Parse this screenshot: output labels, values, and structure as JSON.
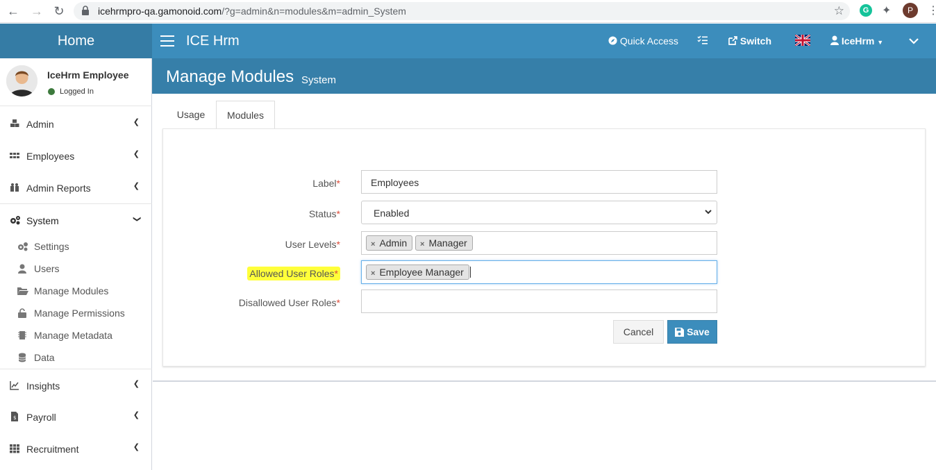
{
  "browser": {
    "url_host": "icehrmpro-qa.gamonoid.com",
    "url_path": "/?g=admin&n=modules&m=admin_System",
    "profile_initial": "P",
    "grammarly_letter": "G"
  },
  "header": {
    "logo_text": "Home",
    "app_title": "ICE Hrm",
    "quick_access": "Quick Access",
    "switch_label": "Switch",
    "user_menu": "IceHrm"
  },
  "user_panel": {
    "name": "IceHrm Employee",
    "status": "Logged In"
  },
  "sidebar": {
    "items": [
      {
        "label": "Admin"
      },
      {
        "label": "Employees"
      },
      {
        "label": "Admin Reports"
      },
      {
        "label": "System"
      },
      {
        "label": "Insights"
      },
      {
        "label": "Payroll"
      },
      {
        "label": "Recruitment"
      }
    ],
    "system_sub": [
      {
        "label": "Settings"
      },
      {
        "label": "Users"
      },
      {
        "label": "Manage Modules"
      },
      {
        "label": "Manage Permissions"
      },
      {
        "label": "Manage Metadata"
      },
      {
        "label": "Data"
      }
    ]
  },
  "page": {
    "title": "Manage Modules",
    "subtitle": "System"
  },
  "tabs": [
    {
      "label": "Usage"
    },
    {
      "label": "Modules"
    }
  ],
  "form": {
    "label_label": "Label",
    "label_value": "Employees",
    "status_label": "Status",
    "status_value": "Enabled",
    "user_levels_label": "User Levels",
    "user_levels": [
      "Admin",
      "Manager"
    ],
    "allowed_roles_label": "Allowed User Roles",
    "allowed_roles": [
      "Employee Manager"
    ],
    "disallowed_roles_label": "Disallowed User Roles",
    "required_mark": "*",
    "cancel_label": "Cancel",
    "save_label": "Save"
  },
  "colors": {
    "header_dark": "#357ca5",
    "header": "#3c8dbc",
    "highlight": "#ffff3a",
    "required": "#dd4b39"
  }
}
